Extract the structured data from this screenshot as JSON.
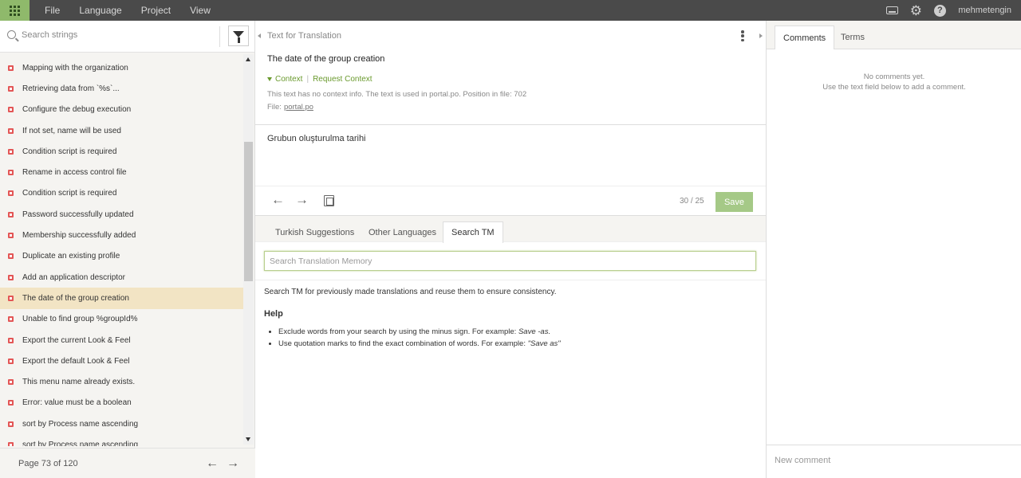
{
  "topbar": {
    "menu": [
      "File",
      "Language",
      "Project",
      "View"
    ],
    "username": "mehmetengin",
    "brand_color": "#8fb96b"
  },
  "left": {
    "search_placeholder": "Search strings",
    "strings": [
      "Mapping with the organization",
      "Retrieving data from `%s`...",
      "Configure the debug execution",
      "If not set, name will be used",
      "Condition script is required",
      "Rename in access control file",
      "Condition script is required",
      "Password successfully updated",
      "Membership successfully added",
      "Duplicate an existing profile",
      "Add an application descriptor",
      "The date of the group creation",
      "Unable to find group %groupId%",
      "Export the current Look & Feel",
      "Export the default Look & Feel",
      "This menu name already exists.",
      "Error: value must be a boolean",
      "sort by Process name ascending",
      "sort by Process name ascending"
    ],
    "active_index": 11,
    "pager": "Page 73 of 120"
  },
  "middle": {
    "source_label": "Text for Translation",
    "source_text": "The date of the group creation",
    "context_label": "Context",
    "request_context": "Request Context",
    "context_info": "This text has no context info. The text is used in portal.po. Position in file: 702",
    "file_label": "File:",
    "file_name": "portal.po",
    "translation": "Grubun oluşturulma tarihi",
    "char_count": "30 / 25",
    "save_label": "Save",
    "tabs": [
      "Turkish Suggestions",
      "Other Languages",
      "Search TM"
    ],
    "active_tab": 2,
    "tm_placeholder": "Search Translation Memory",
    "tm_description": "Search TM for previously made translations and reuse them to ensure consistency.",
    "help_title": "Help",
    "help_items": [
      {
        "text": "Exclude words from your search by using the minus sign. For example: ",
        "example": "Save -as."
      },
      {
        "text": "Use quotation marks to find the exact combination of words. For example: ",
        "example": "\"Save as\""
      }
    ]
  },
  "right": {
    "tabs": [
      "Comments",
      "Terms"
    ],
    "active_tab": 0,
    "no_comments_line1": "No comments yet.",
    "no_comments_line2": "Use the text field below to add a comment.",
    "comment_placeholder": "New comment"
  }
}
